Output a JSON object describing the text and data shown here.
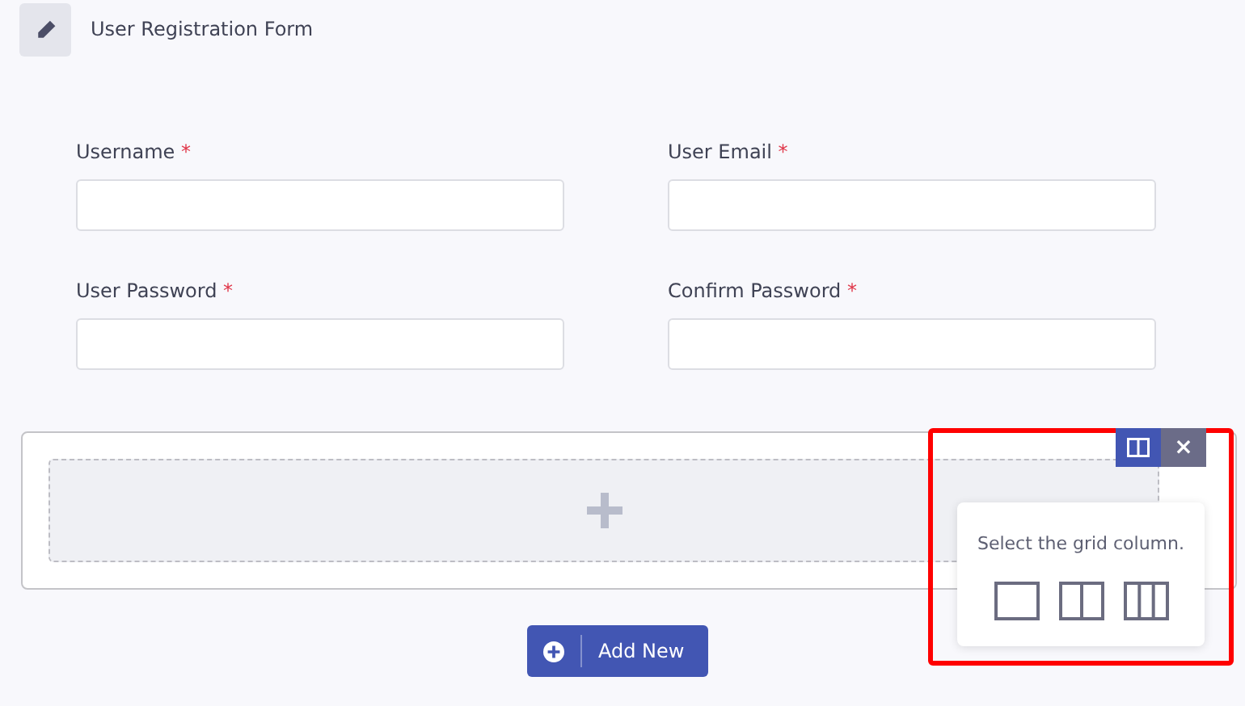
{
  "header": {
    "title": "User Registration Form"
  },
  "fields": [
    {
      "label": "Username",
      "required_mark": "*"
    },
    {
      "label": "User Email",
      "required_mark": "*"
    },
    {
      "label": "User Password",
      "required_mark": "*"
    },
    {
      "label": "Confirm Password",
      "required_mark": "*"
    }
  ],
  "grid_toolbar": {
    "buttons": [
      {
        "kind": "columns",
        "selected": true
      },
      {
        "kind": "close",
        "text": "×",
        "selected": false
      }
    ]
  },
  "popover": {
    "text": "Select the grid column.",
    "options": [
      {
        "kind": "one"
      },
      {
        "kind": "two"
      },
      {
        "kind": "three"
      }
    ]
  },
  "highlight": true,
  "add_button": {
    "label": "Add New"
  }
}
